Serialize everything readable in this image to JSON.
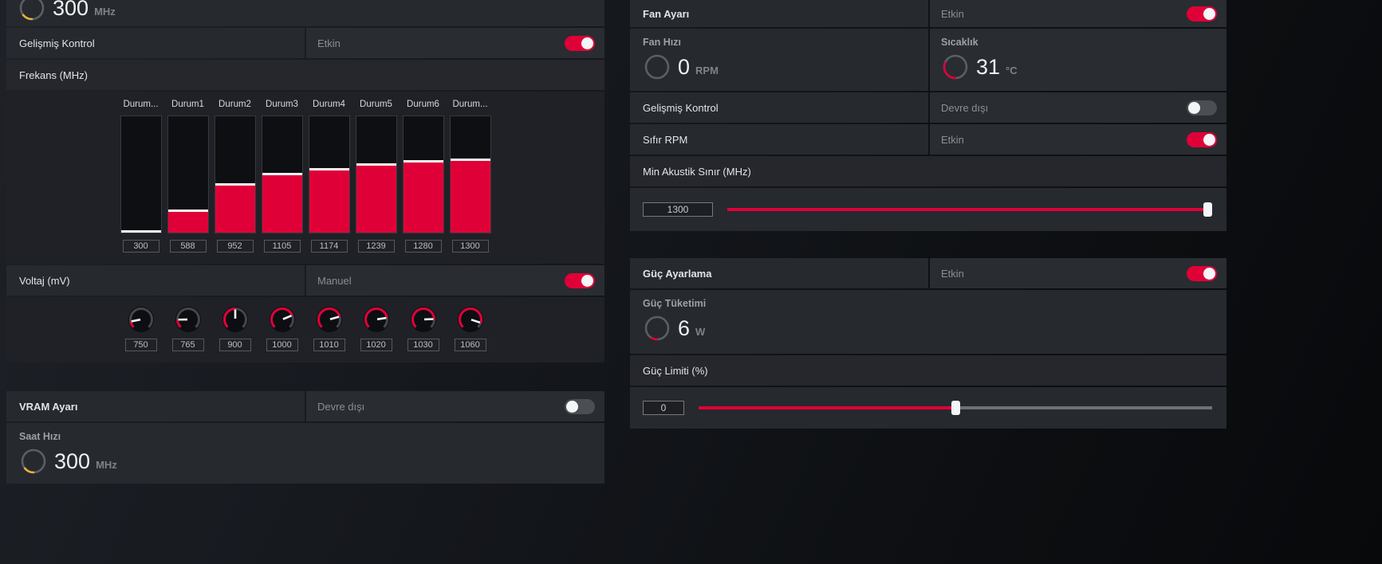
{
  "accent": "#e00038",
  "chart_data": {
    "type": "bar",
    "title": "Frekans (MHz)",
    "categories": [
      "Durum...",
      "Durum1",
      "Durum2",
      "Durum3",
      "Durum4",
      "Durum5",
      "Durum6",
      "Durum..."
    ],
    "values": [
      300,
      588,
      952,
      1105,
      1174,
      1239,
      1280,
      1300
    ],
    "ylim": [
      0,
      2100
    ]
  },
  "left": {
    "top_gauge": {
      "value": "300",
      "unit": "MHz",
      "fraction": 0.14,
      "color": "#e8b03c"
    },
    "advanced_control": {
      "label": "Gelişmiş Kontrol",
      "status": "Etkin",
      "on": true
    },
    "frequency_header": "Frekans (MHz)",
    "voltage": {
      "label": "Voltaj (mV)",
      "status": "Manuel",
      "on": true
    },
    "knobs": {
      "values": [
        750,
        765,
        900,
        1000,
        1010,
        1020,
        1030,
        1060
      ]
    },
    "vram": {
      "label": "VRAM Ayarı",
      "status": "Devre dışı",
      "on": false
    },
    "clock": {
      "label": "Saat Hızı",
      "value": "300",
      "unit": "MHz",
      "fraction": 0.14,
      "color": "#e8b03c"
    }
  },
  "right": {
    "fan": {
      "label": "Fan Ayarı",
      "status": "Etkin",
      "on": true
    },
    "fan_speed": {
      "label": "Fan Hızı",
      "value": "0",
      "unit": "RPM",
      "fraction": 0
    },
    "temperature": {
      "label": "Sıcaklık",
      "value": "31",
      "unit": "°C",
      "fraction": 0.31
    },
    "advanced_control": {
      "label": "Gelişmiş Kontrol",
      "status": "Devre dışı",
      "on": false
    },
    "zero_rpm": {
      "label": "Sıfır RPM",
      "status": "Etkin",
      "on": true
    },
    "min_acoustic": {
      "label": "Min Akustik Sınır (MHz)",
      "value": "1300",
      "fraction": 1
    },
    "power_tuning": {
      "label": "Güç Ayarlama",
      "status": "Etkin",
      "on": true
    },
    "power_draw": {
      "label": "Güç Tüketimi",
      "value": "6",
      "unit": "W",
      "fraction": 0.08
    },
    "power_limit": {
      "label": "Güç Limiti (%)",
      "value": "0",
      "fraction": 0.5
    }
  }
}
